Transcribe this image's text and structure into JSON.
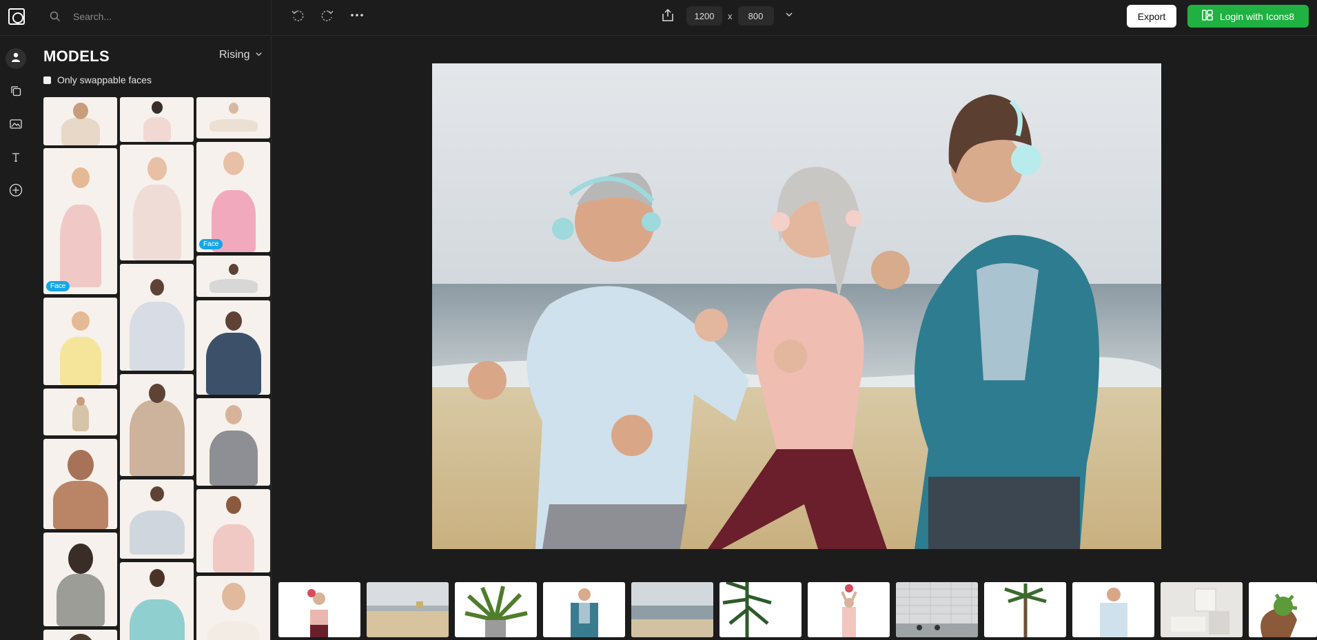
{
  "search": {
    "placeholder": "Search...",
    "icon": "search-icon"
  },
  "toolbar": {
    "undo_icon": "undo-icon",
    "redo_icon": "redo-icon",
    "more_icon": "more-icon",
    "share_icon": "share-icon",
    "width": "1200",
    "height": "800",
    "size_separator": "x",
    "export_label": "Export",
    "login_label": "Login with Icons8"
  },
  "rail": {
    "items": [
      {
        "name": "models",
        "icon": "user-icon",
        "active": true
      },
      {
        "name": "layers",
        "icon": "copy-icon",
        "active": false
      },
      {
        "name": "backgrounds",
        "icon": "image-icon",
        "active": false
      },
      {
        "name": "text",
        "icon": "text-icon",
        "active": false
      },
      {
        "name": "add",
        "icon": "plus-circle-icon",
        "active": false
      }
    ]
  },
  "panel": {
    "title": "MODELS",
    "sort_label": "Rising",
    "swappable_label": "Only swappable faces",
    "badge_face": "Face"
  },
  "colors": {
    "accent_green": "#1fb141",
    "badge_blue": "#15a6e8",
    "background": "#1c1c1c"
  }
}
